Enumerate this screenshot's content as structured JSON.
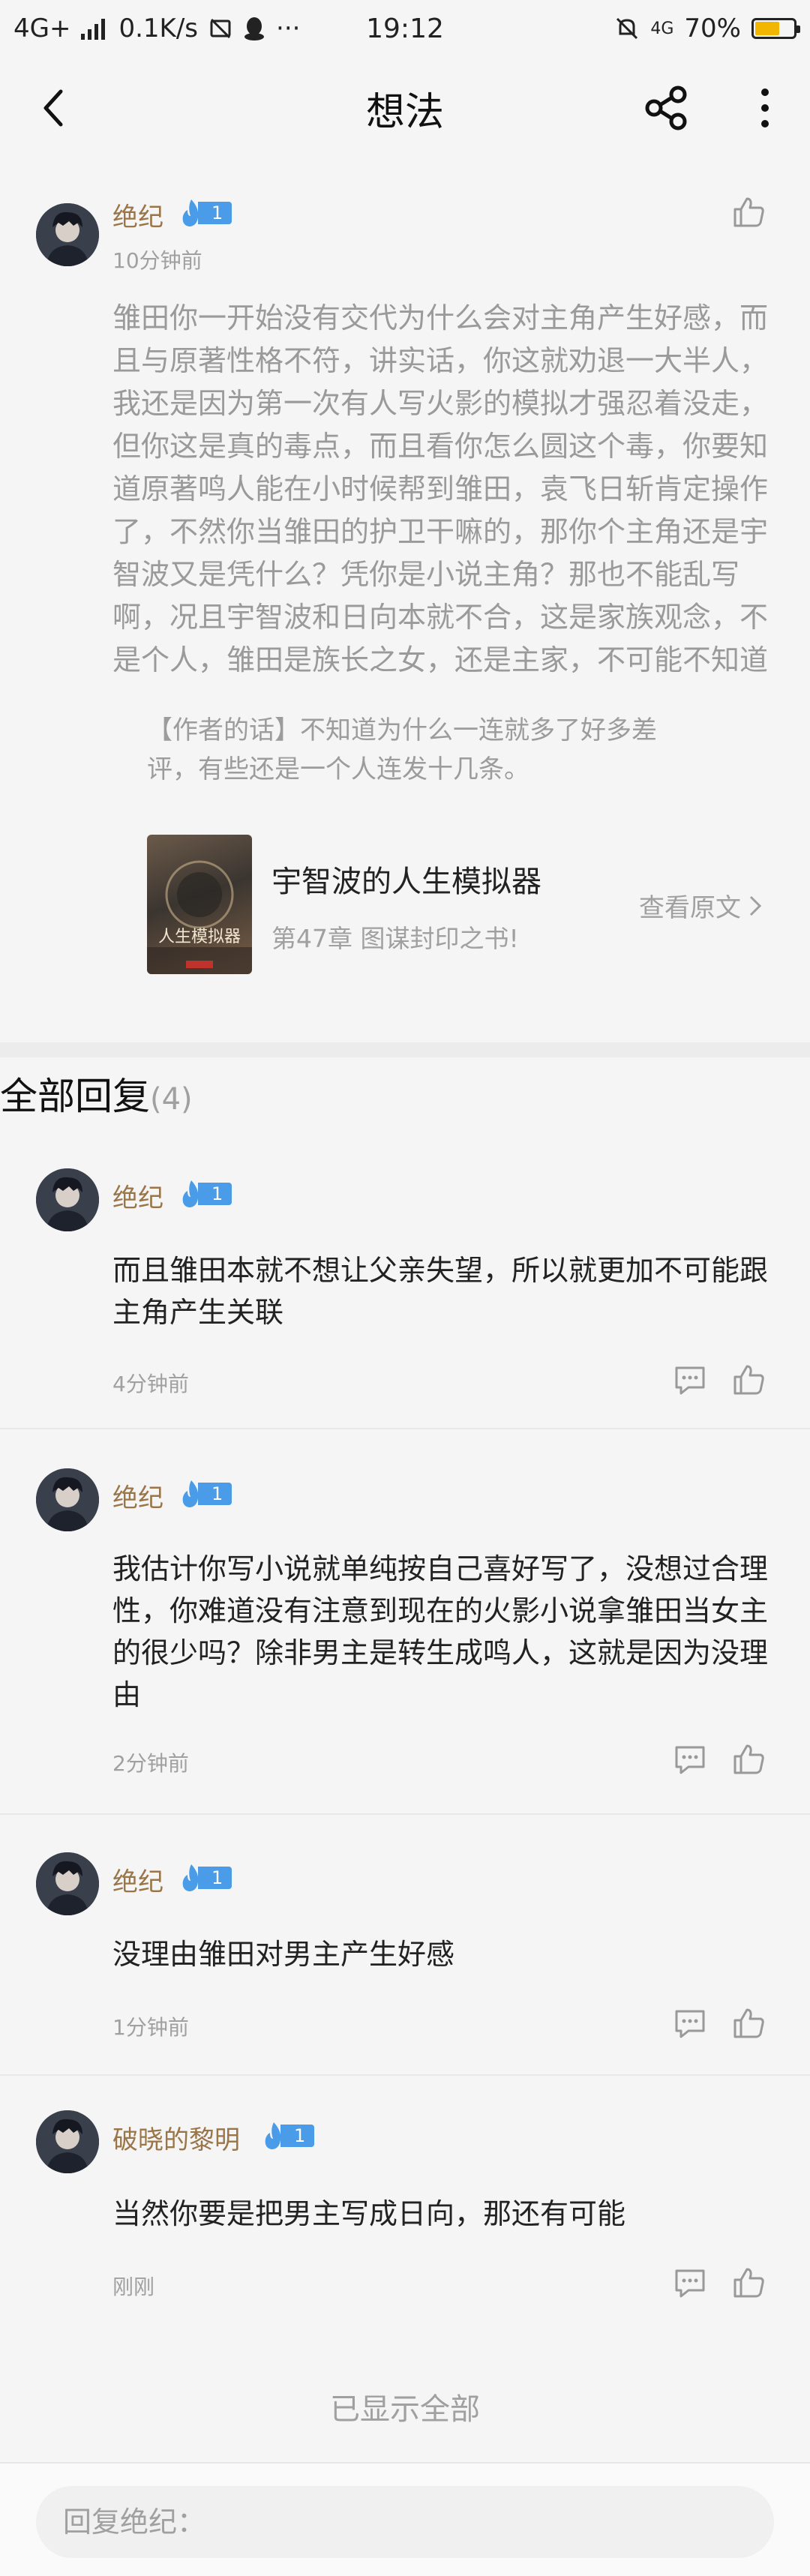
{
  "status_bar": {
    "network": "4G+",
    "speed": "0.1K/s",
    "time": "19:12",
    "net_right": "4G",
    "battery": "70%"
  },
  "nav": {
    "title": "想法"
  },
  "post": {
    "author": "绝纪",
    "level": "1",
    "time": "10分钟前",
    "text": "雏田你一开始没有交代为什么会对主角产生好感，而且与原著性格不符，讲实话，你这就劝退一大半人，我还是因为第一次有人写火影的模拟才强忍着没走，但你这是真的毒点，而且看你怎么圆这个毒，你要知道原著鸣人能在小时候帮到雏田，袁飞日斩肯定操作了，不然你当雏田的护卫干嘛的，那你个主角还是宇智波又是凭什么？凭你是小说主角？那也不能乱写啊，况且宇智波和日向本就不合，这是家族观念，不是个人，雏田是族长之女，还是主家，不可能不知道",
    "author_note": "【作者的话】不知道为什么一连就多了好多差评，有些还是一个人连发十几条。",
    "book": {
      "title": "宇智波的人生模拟器",
      "chapter": "第47章 图谋封印之书!",
      "link": "查看原文",
      "cover_text": "人生模拟器"
    }
  },
  "replies_section": {
    "title": "全部回复",
    "count": "(4)"
  },
  "replies": [
    {
      "author": "绝纪",
      "level": "1",
      "text": "而且雏田本就不想让父亲失望，所以就更加不可能跟主角产生关联",
      "time": "4分钟前"
    },
    {
      "author": "绝纪",
      "level": "1",
      "text": "我估计你写小说就单纯按自己喜好写了，没想过合理性，你难道没有注意到现在的火影小说拿雏田当女主的很少吗？除非男主是转生成鸣人，这就是因为没理由",
      "time": "2分钟前"
    },
    {
      "author": "绝纪",
      "level": "1",
      "text": "没理由雏田对男主产生好感",
      "time": "1分钟前"
    },
    {
      "author": "破晓的黎明",
      "level": "1",
      "text": "当然你要是把男主写成日向，那还有可能",
      "time": "刚刚"
    }
  ],
  "footer": {
    "show_all": "已显示全部",
    "reply_placeholder": "回复绝纪："
  },
  "colors": {
    "username": "#9a7548",
    "badge": "#4a9be8",
    "battery": "#f2b600"
  }
}
